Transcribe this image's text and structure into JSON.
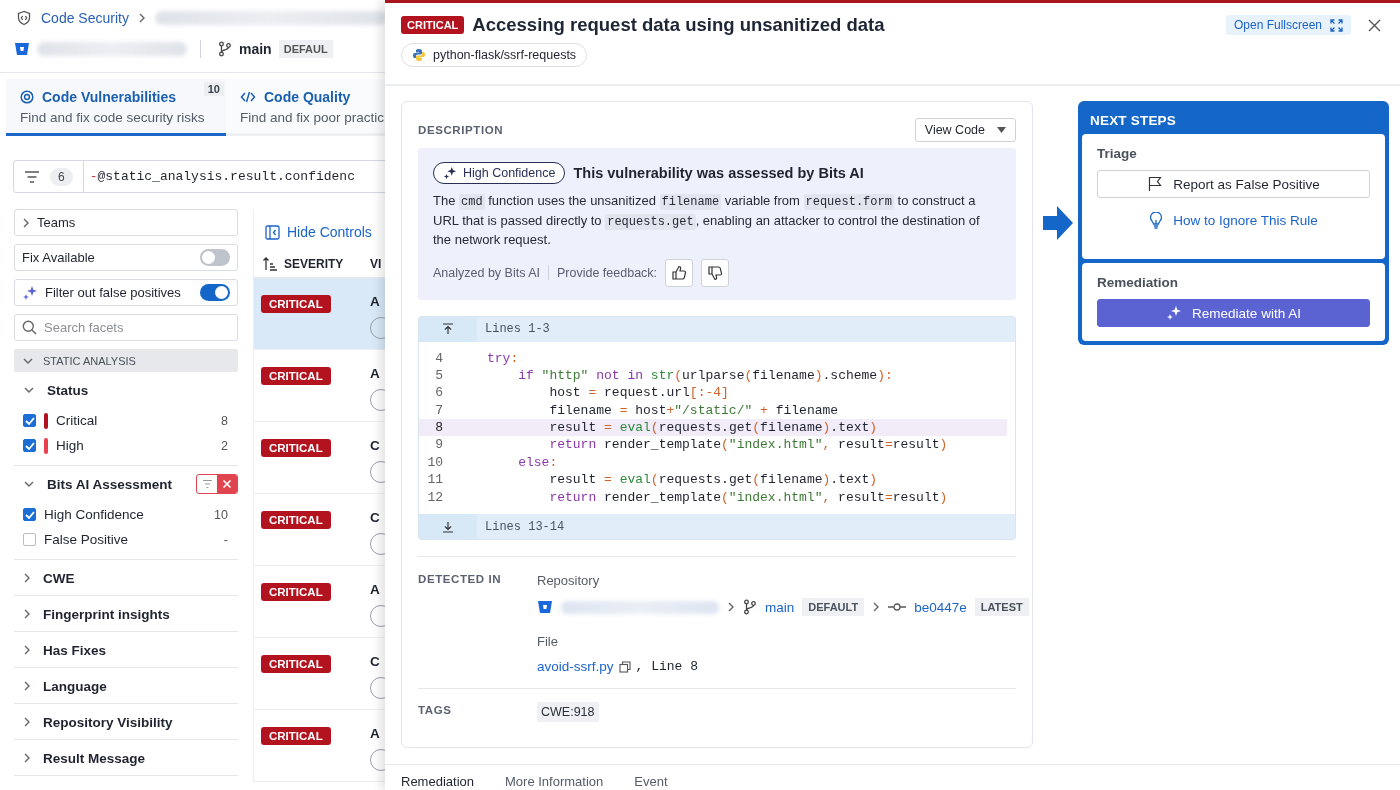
{
  "breadcrumb": {
    "product": "Code Security"
  },
  "repo_bar": {
    "branch": "main",
    "branch_tag": "DEFAUL"
  },
  "tabs": [
    {
      "title": "Code Vulnerabilities",
      "subtitle": "Find and fix code security risks",
      "count": "10",
      "selected": true,
      "kind": "security"
    },
    {
      "title": "Code Quality",
      "subtitle": "Find and fix poor practic",
      "selected": false,
      "kind": "quality"
    }
  ],
  "query": {
    "filter_count": "6",
    "segments": [
      {
        "kind": "operator",
        "text": "-"
      },
      {
        "kind": "term",
        "text": "@static_analysis.result.confidenc"
      }
    ]
  },
  "facets": {
    "teams": {
      "label": "Teams"
    },
    "toggles": [
      {
        "label": "Fix Available",
        "on": false,
        "kind": "plain"
      },
      {
        "label": "Filter out false positives",
        "on": true,
        "kind": "ai"
      }
    ],
    "search": {
      "placeholder": "Search facets"
    },
    "section": {
      "label": "STATIC ANALYSIS"
    },
    "groups": [
      {
        "label": "Status",
        "expanded": true,
        "filtered": false,
        "options": [
          {
            "label": "Critical",
            "count": "8",
            "checked": true,
            "color": "#b0101f"
          },
          {
            "label": "High",
            "count": "2",
            "checked": true,
            "color": "#e8404f"
          }
        ]
      },
      {
        "label": "Bits AI Assessment",
        "expanded": true,
        "filtered": true,
        "options": [
          {
            "label": "High Confidence",
            "count": "10",
            "checked": true
          },
          {
            "label": "False Positive",
            "count": "-",
            "checked": false
          }
        ]
      },
      {
        "label": "CWE",
        "expanded": false
      },
      {
        "label": "Fingerprint insights",
        "expanded": false
      },
      {
        "label": "Has Fixes",
        "expanded": false
      },
      {
        "label": "Language",
        "expanded": false
      },
      {
        "label": "Repository Visibility",
        "expanded": false
      },
      {
        "label": "Result Message",
        "expanded": false
      }
    ]
  },
  "table": {
    "hide_controls": "Hide Controls",
    "columns": [
      "SEVERITY",
      "VI"
    ],
    "rows": [
      {
        "severity": "CRITICAL",
        "title": "A",
        "selected": true
      },
      {
        "severity": "CRITICAL",
        "title": "A",
        "selected": false
      },
      {
        "severity": "CRITICAL",
        "title": "C",
        "selected": false
      },
      {
        "severity": "CRITICAL",
        "title": "C",
        "selected": false
      },
      {
        "severity": "CRITICAL",
        "title": "A",
        "selected": false
      },
      {
        "severity": "CRITICAL",
        "title": "C",
        "selected": false
      },
      {
        "severity": "CRITICAL",
        "title": "A",
        "selected": false
      }
    ]
  },
  "detail": {
    "severity": "CRITICAL",
    "title": "Accessing request data using unsanitized data",
    "rule": "python-flask/ssrf-requests",
    "fullscreen": "Open Fullscreen",
    "description": {
      "heading": "DESCRIPTION",
      "view_menu": "View Code",
      "ai": {
        "confidence": "High Confidence",
        "title": "This vulnerability was assessed by Bits AI",
        "text": [
          {
            "kind": "text",
            "text": "The "
          },
          {
            "kind": "code",
            "text": "cmd"
          },
          {
            "kind": "text",
            "text": " function uses the unsanitized "
          },
          {
            "kind": "code",
            "text": "filename"
          },
          {
            "kind": "text",
            "text": " variable from "
          },
          {
            "kind": "code",
            "text": "request.form"
          },
          {
            "kind": "text",
            "text": " to construct a URL that is passed directly to "
          },
          {
            "kind": "code",
            "text": "requests.get"
          },
          {
            "kind": "text",
            "text": ", enabling an attacker to control the destination of the network request."
          }
        ],
        "analyzed_by": "Analyzed by Bits AI",
        "feedback": "Provide feedback:"
      }
    },
    "code": {
      "above": "Lines 1-3",
      "below": "Lines 13-14",
      "lines": [
        {
          "number": "4",
          "highlighted": false,
          "tokens": [
            {
              "kind": "kw",
              "text": "try"
            },
            {
              "kind": "op",
              "text": ":"
            }
          ]
        },
        {
          "number": "5",
          "highlighted": false,
          "tokens": [
            {
              "kind": "kw",
              "text": "    if"
            },
            {
              "kind": "str",
              "text": " \"http\""
            },
            {
              "kind": "kw",
              "text": " not in"
            },
            {
              "kind": "fn",
              "text": " str"
            },
            {
              "kind": "op",
              "text": "("
            },
            {
              "kind": "plain",
              "text": "urlparse"
            },
            {
              "kind": "op",
              "text": "("
            },
            {
              "kind": "plain",
              "text": "filename"
            },
            {
              "kind": "op",
              "text": ")"
            },
            {
              "kind": "plain",
              "text": ".scheme"
            },
            {
              "kind": "op",
              "text": "):"
            }
          ]
        },
        {
          "number": "6",
          "highlighted": false,
          "tokens": [
            {
              "kind": "plain",
              "text": "        host "
            },
            {
              "kind": "op",
              "text": "="
            },
            {
              "kind": "plain",
              "text": " request.url"
            },
            {
              "kind": "op",
              "text": "[:-4]"
            }
          ]
        },
        {
          "number": "7",
          "highlighted": false,
          "tokens": [
            {
              "kind": "plain",
              "text": "        filename "
            },
            {
              "kind": "op",
              "text": "="
            },
            {
              "kind": "plain",
              "text": " host"
            },
            {
              "kind": "op",
              "text": "+"
            },
            {
              "kind": "str",
              "text": "\"/static/\""
            },
            {
              "kind": "op",
              "text": " +"
            },
            {
              "kind": "plain",
              "text": " filename"
            }
          ]
        },
        {
          "number": "8",
          "highlighted": true,
          "tokens": [
            {
              "kind": "plain",
              "text": "        result "
            },
            {
              "kind": "op",
              "text": "="
            },
            {
              "kind": "fn",
              "text": " eval"
            },
            {
              "kind": "op",
              "text": "("
            },
            {
              "kind": "plain",
              "text": "requests.get"
            },
            {
              "kind": "op",
              "text": "("
            },
            {
              "kind": "plain",
              "text": "filename"
            },
            {
              "kind": "op",
              "text": ")"
            },
            {
              "kind": "plain",
              "text": ".text"
            },
            {
              "kind": "op",
              "text": ")"
            }
          ]
        },
        {
          "number": "9",
          "highlighted": false,
          "tokens": [
            {
              "kind": "kw",
              "text": "        return"
            },
            {
              "kind": "plain",
              "text": " render_template"
            },
            {
              "kind": "op",
              "text": "("
            },
            {
              "kind": "str",
              "text": "\"index.html\""
            },
            {
              "kind": "op",
              "text": ","
            },
            {
              "kind": "plain",
              "text": " result"
            },
            {
              "kind": "op",
              "text": "="
            },
            {
              "kind": "plain",
              "text": "result"
            },
            {
              "kind": "op",
              "text": ")"
            }
          ]
        },
        {
          "number": "10",
          "highlighted": false,
          "tokens": [
            {
              "kind": "kw",
              "text": "    else"
            },
            {
              "kind": "op",
              "text": ":"
            }
          ]
        },
        {
          "number": "11",
          "highlighted": false,
          "tokens": [
            {
              "kind": "plain",
              "text": "        result "
            },
            {
              "kind": "op",
              "text": "="
            },
            {
              "kind": "fn",
              "text": " eval"
            },
            {
              "kind": "op",
              "text": "("
            },
            {
              "kind": "plain",
              "text": "requests.get"
            },
            {
              "kind": "op",
              "text": "("
            },
            {
              "kind": "plain",
              "text": "filename"
            },
            {
              "kind": "op",
              "text": ")"
            },
            {
              "kind": "plain",
              "text": ".text"
            },
            {
              "kind": "op",
              "text": ")"
            }
          ]
        },
        {
          "number": "12",
          "highlighted": false,
          "tokens": [
            {
              "kind": "kw",
              "text": "        return"
            },
            {
              "kind": "plain",
              "text": " render_template"
            },
            {
              "kind": "op",
              "text": "("
            },
            {
              "kind": "str",
              "text": "\"index.html\""
            },
            {
              "kind": "op",
              "text": ","
            },
            {
              "kind": "plain",
              "text": " result"
            },
            {
              "kind": "op",
              "text": "="
            },
            {
              "kind": "plain",
              "text": "result"
            },
            {
              "kind": "op",
              "text": ")"
            }
          ]
        }
      ]
    },
    "detected_in": {
      "heading": "DETECTED IN",
      "repository_label": "Repository",
      "branch": "main",
      "branch_tag": "DEFAULT",
      "commit": "be0447e",
      "commit_tag": "LATEST",
      "file_label": "File",
      "file": "avoid-ssrf.py",
      "line": ", Line 8"
    },
    "tags": {
      "heading": "TAGS",
      "items": [
        "CWE:918"
      ]
    },
    "bottom_tabs": [
      {
        "label": "Remediation",
        "selected": true
      },
      {
        "label": "More Information",
        "selected": false
      },
      {
        "label": "Event",
        "selected": false
      }
    ]
  },
  "next_steps": {
    "title": "NEXT STEPS",
    "triage": {
      "label": "Triage",
      "report": "Report as False Positive",
      "ignore": "How to Ignore This Rule"
    },
    "remediation": {
      "label": "Remediation",
      "button": "Remediate with AI"
    }
  }
}
